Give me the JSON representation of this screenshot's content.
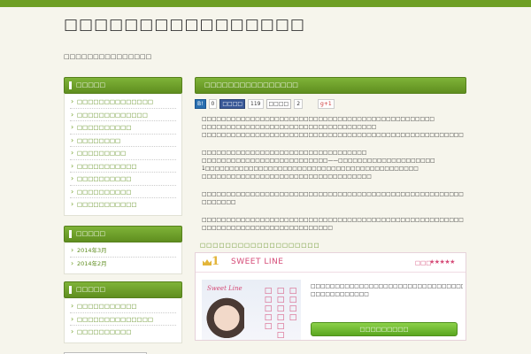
{
  "header": {
    "title": "□□□□□□□□□□□□□□□□",
    "description": "□□□□□□□□□□□□□□□"
  },
  "sidebar": {
    "widgets": [
      {
        "heading": "□□□□□",
        "items": [
          "□□□□□□□□□□□□□□",
          "□□□□□□□□□□□□□",
          "□□□□□□□□□□",
          "□□□□□□□□",
          "□□□□□□□□□",
          "□□□□□□□□□□□",
          "□□□□□□□□□□",
          "□□□□□□□□□□",
          "□□□□□□□□□□□"
        ]
      },
      {
        "heading": "□□□□□",
        "items": [
          "2014年3月",
          "2014年2月"
        ]
      },
      {
        "heading": "□□□□□",
        "items": [
          "□□□□□□□□□□□",
          "□□□□□□□□□□□□□□",
          "□□□□□□□□□□"
        ]
      }
    ]
  },
  "post": {
    "title": "□□□□□□□□□□□□□□□□",
    "share": {
      "b_label": "B!",
      "b_count": "0",
      "fb_label": "□□□□",
      "fb_count": "119",
      "tw_label": "□□□□",
      "tw_count": "2",
      "gplus_label": "g+1"
    },
    "paragraphs": [
      [
        "□□□□□□□□□□□□□□□□□□□□□□□□□□□□□□□□□□□□□□□□□□□□□□□□",
        "□□□□□□□□□□□□□□□□□□□□□□□□□□□□□□□□□□□□",
        "□□□□□□□□□□□□□□□□□□□□□□□□□□□□□□□□□□□□□□□□□□□□□□□□□□□□□□□□□"
      ],
      [
        "□□□□□□□□□□□□□□□□□□□□□□□□□□□□□□□□□□",
        "□□□□□□□□□□□□□□□□□□□□□□□□□□——□□□□□□□□□□□□□□□□□□□□",
        "1□□□□□□□□□□□□□□□□□□□□□□□□□□□□□□□□□□□□□□□□□□□□",
        "□□□□□□□□□□□□□□□□□□□□□□□□□□□□□□□□□□□"
      ],
      [
        "□□□□□□□□□□□□□□□□□□□□□□□□□□□□□□□□□□□□□□□□□□□□□□□□□□□□□□□□□□□□□□□□□□□□□□□□□□□□□□□□□□□□□□□□",
        "□□□□□□□"
      ],
      [
        "□□□□□□□□□□□□□□□□□□□□□□□□□□□□□□□□□□□□□□□□□□□□□□□□□□□□□□□□□□□□□□□□□□□□□□□□□□□□□□□□□□□□□□□□",
        "□□□□□□□□□□□□□□□□□□□□□□□□□□□"
      ]
    ],
    "ranking_title": "□□□□□□□□□□□□□□□□□□□",
    "ranking": {
      "rank": "1",
      "name": "SWEET LINE",
      "stars_label": "□□□",
      "stars": "★★★★★",
      "banner_logo": "Sweet Line",
      "banner_lines": [
        "□□□□",
        "□□□□□□□",
        "□□□□□"
      ],
      "description": [
        "□□□□□□□□□□□□□□□□□□□□□□□□□□□□□□□□□□□□□□□□□",
        "□□□□□□□□□□□□"
      ],
      "button": "□□□□□□□□□"
    }
  }
}
